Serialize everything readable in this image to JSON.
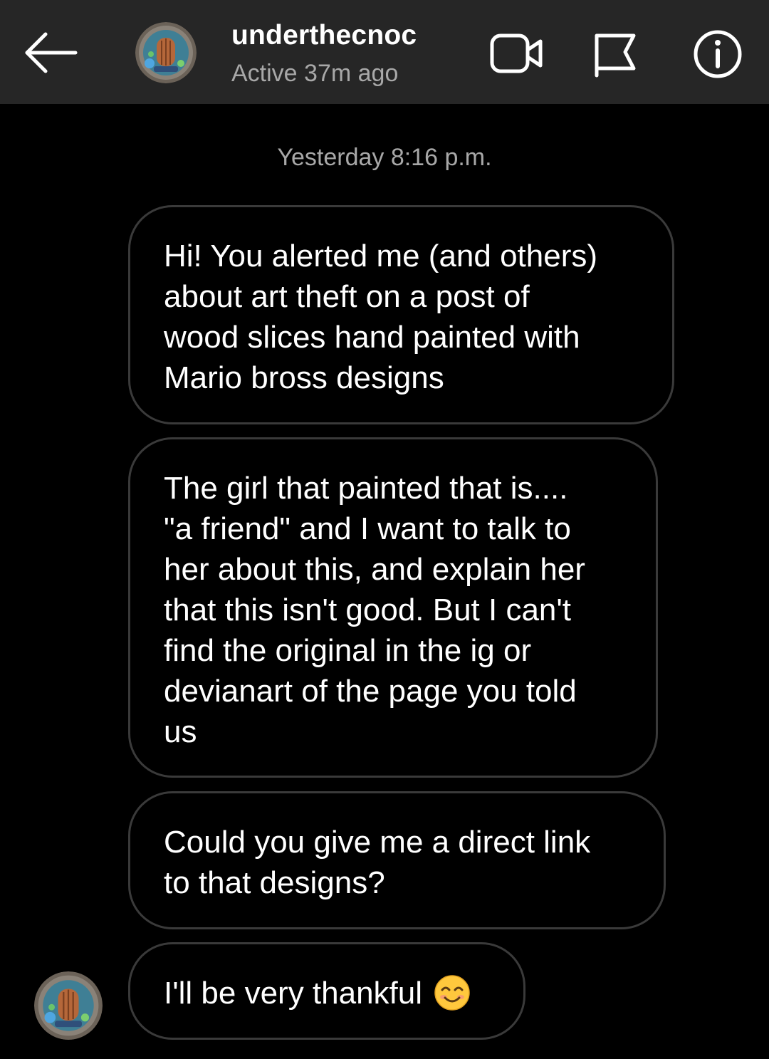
{
  "header": {
    "username": "underthecnoc",
    "status": "Active 37m ago",
    "icons": {
      "back": "arrow-left-icon",
      "video": "video-call-icon",
      "flag": "flag-icon",
      "info": "info-icon"
    }
  },
  "conversation": {
    "timestamp": "Yesterday 8:16 p.m.",
    "messages": [
      {
        "text": "Hi! You alerted me (and others)\nabout art theft on a post of\nwood slices hand painted with\nMario bross designs"
      },
      {
        "text": "The girl that painted that is....\n\"a friend\" and I want to talk to\nher about this, and explain her\nthat this isn't good. But I can't\nfind the original in the ig or\ndevianart of the page you told\nus"
      },
      {
        "text": "Could you give me a direct link\nto that designs?"
      },
      {
        "text": "I'll be very thankful",
        "emoji": "smiling-face-emoji"
      }
    ]
  },
  "colors": {
    "header_bg": "#262626",
    "background": "#000000",
    "bubble_border": "#3a3a3a",
    "secondary_text": "#a8a8a8",
    "text": "#ffffff"
  }
}
